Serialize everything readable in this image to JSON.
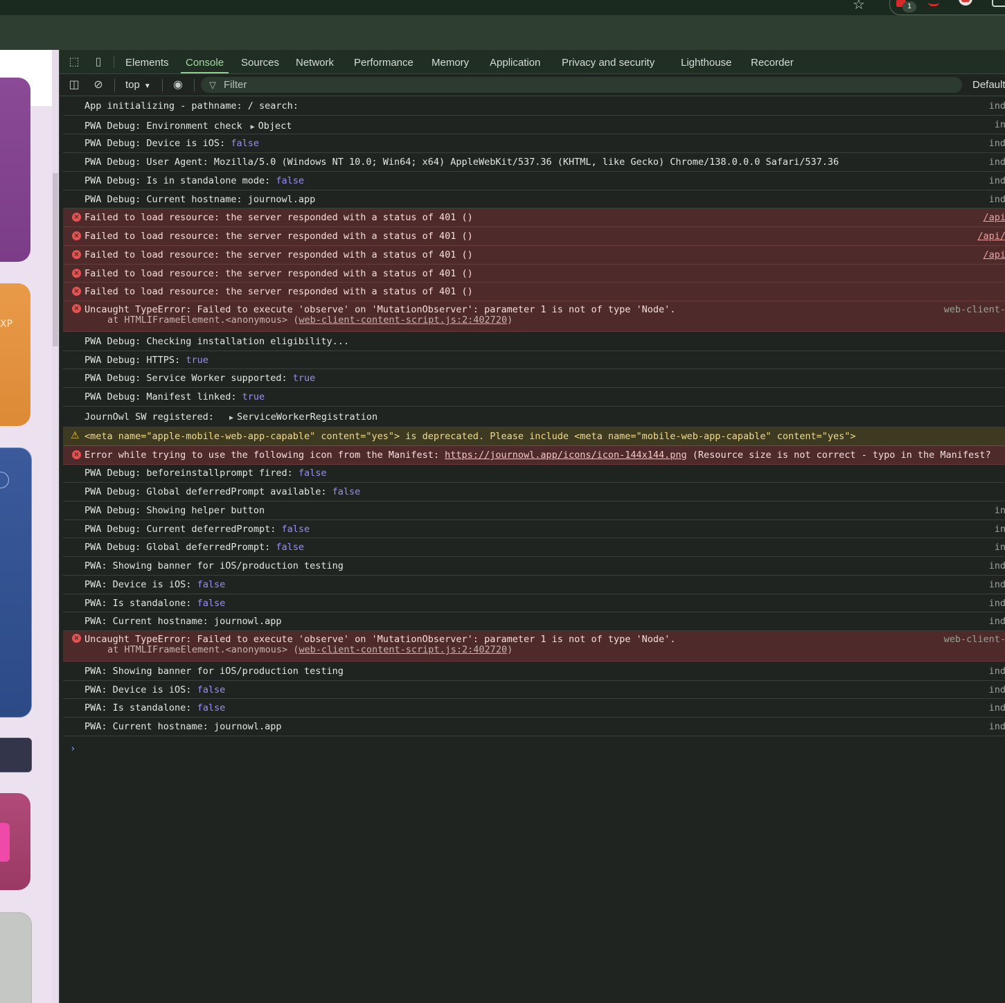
{
  "chrome": {
    "bookmark_icon": "star-icon",
    "extension_badge": "1"
  },
  "devtools": {
    "tabs": [
      "Elements",
      "Console",
      "Sources",
      "Network",
      "Performance",
      "Memory",
      "Application",
      "Privacy and security",
      "Lighthouse",
      "Recorder"
    ],
    "active_tab": "Console",
    "toolbar": {
      "context": "top",
      "filter_placeholder": "Filter",
      "levels": "Default"
    }
  },
  "console": {
    "messages": [
      {
        "type": "log",
        "text": "App initializing - pathname: / search:",
        "source": "ind"
      },
      {
        "type": "log",
        "text": "PWA Debug: Environment check",
        "obj": "Object",
        "source": "in"
      },
      {
        "type": "log",
        "text": "PWA Debug: Device is iOS:",
        "val": "false",
        "source": "ind"
      },
      {
        "type": "log",
        "text": "PWA Debug: User Agent: Mozilla/5.0 (Windows NT 10.0; Win64; x64) AppleWebKit/537.36 (KHTML, like Gecko) Chrome/138.0.0.0 Safari/537.36",
        "source": "ind"
      },
      {
        "type": "log",
        "text": "PWA Debug: Is in standalone mode:",
        "val": "false",
        "source": "ind"
      },
      {
        "type": "log",
        "text": "PWA Debug: Current hostname: journowl.app",
        "source": "ind"
      },
      {
        "type": "error",
        "text": "Failed to load resource: the server responded with a status of 401 ()",
        "source": "/api"
      },
      {
        "type": "error",
        "text": "Failed to load resource: the server responded with a status of 401 ()",
        "source": "/api/"
      },
      {
        "type": "error",
        "text": "Failed to load resource: the server responded with a status of 401 ()",
        "source": "/api"
      },
      {
        "type": "error",
        "text": "Failed to load resource: the server responded with a status of 401 ()",
        "source": ""
      },
      {
        "type": "error",
        "text": "Failed to load resource: the server responded with a status of 401 ()",
        "source": ""
      },
      {
        "type": "error2",
        "text": "Uncaught TypeError: Failed to execute 'observe' on 'MutationObserver': parameter 1 is not of type 'Node'.",
        "stack_prefix": "at HTMLIFrameElement.<anonymous> (",
        "stack_link": "web-client-content-script.js:2:402720",
        "stack_suffix": ")",
        "source": "web-client-"
      },
      {
        "type": "log",
        "text": "PWA Debug: Checking installation eligibility...",
        "source": ""
      },
      {
        "type": "log",
        "text": "PWA Debug: HTTPS:",
        "val": "true",
        "source": ""
      },
      {
        "type": "log",
        "text": "PWA Debug: Service Worker supported:",
        "val": "true",
        "source": ""
      },
      {
        "type": "log",
        "text": "PWA Debug: Manifest linked:",
        "val": "true",
        "source": ""
      },
      {
        "type": "log",
        "text": "JournOwl SW registered:",
        "obj": "ServiceWorkerRegistration",
        "source": ""
      },
      {
        "type": "warn",
        "text": "<meta name=\"apple-mobile-web-app-capable\" content=\"yes\"> is deprecated. Please include <meta name=\"mobile-web-app-capable\" content=\"yes\">",
        "source": ""
      },
      {
        "type": "error",
        "text": "Error while trying to use the following icon from the Manifest: ",
        "url": "https://journowl.app/icons/icon-144x144.png",
        "tail": " (Resource size is not correct - typo in the Manifest?",
        "source": ""
      },
      {
        "type": "log",
        "text": "PWA Debug: beforeinstallprompt fired:",
        "val": "false",
        "source": ""
      },
      {
        "type": "log",
        "text": "PWA Debug: Global deferredPrompt available:",
        "val": "false",
        "source": ""
      },
      {
        "type": "log",
        "text": "PWA Debug: Showing helper button",
        "source": "in"
      },
      {
        "type": "log",
        "text": "PWA Debug: Current deferredPrompt:",
        "val": "false",
        "source": "in"
      },
      {
        "type": "log",
        "text": "PWA Debug: Global deferredPrompt:",
        "val": "false",
        "source": "in"
      },
      {
        "type": "log",
        "text": "PWA: Showing banner for iOS/production testing",
        "source": "ind"
      },
      {
        "type": "log",
        "text": "PWA: Device is iOS:",
        "val": "false",
        "source": "ind"
      },
      {
        "type": "log",
        "text": "PWA: Is standalone:",
        "val": "false",
        "source": "ind"
      },
      {
        "type": "log",
        "text": "PWA: Current hostname: journowl.app",
        "source": "ind"
      },
      {
        "type": "error2",
        "text": "Uncaught TypeError: Failed to execute 'observe' on 'MutationObserver': parameter 1 is not of type 'Node'.",
        "stack_prefix": "at HTMLIFrameElement.<anonymous> (",
        "stack_link": "web-client-content-script.js:2:402720",
        "stack_suffix": ")",
        "source": "web-client-"
      },
      {
        "type": "log",
        "text": "PWA: Showing banner for iOS/production testing",
        "source": "ind"
      },
      {
        "type": "log",
        "text": "PWA: Device is iOS:",
        "val": "false",
        "source": "ind"
      },
      {
        "type": "log",
        "text": "PWA: Is standalone:",
        "val": "false",
        "source": "ind"
      },
      {
        "type": "log",
        "text": "PWA: Current hostname: journowl.app",
        "source": "ind"
      }
    ],
    "prompt_symbol": "›"
  },
  "page": {
    "card_text": "XP"
  },
  "colors": {
    "error_bg": "#4f2a2b",
    "warn_bg": "#3e3a22",
    "keyword": "#9c8ef0",
    "active_tab": "#a6d9a6"
  }
}
